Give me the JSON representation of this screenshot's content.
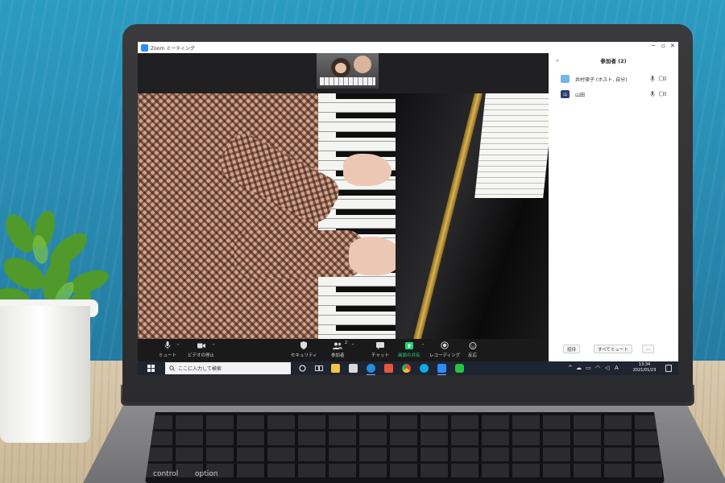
{
  "window": {
    "title": "Zoom ミーティング"
  },
  "toolbar": {
    "mute": "ミュート",
    "stop_video": "ビデオの停止",
    "security": "セキュリティ",
    "participants": "参加者",
    "participants_count": "2",
    "chat": "チャット",
    "share_screen": "画面の共有",
    "record": "レコーディング",
    "reactions": "反応"
  },
  "participants_panel": {
    "title": "参加者 (2)",
    "participants": [
      {
        "name": "井村律子 (ホスト, 自分)",
        "avatar_text": "",
        "avatar_color": "#6fb8e8"
      },
      {
        "name": "山田",
        "avatar_text": "山",
        "avatar_color": "#2b3d6e"
      }
    ],
    "invite_label": "招待",
    "mute_all_label": "すべてミュート",
    "more_label": "..."
  },
  "taskbar": {
    "search_placeholder": "ここに入力して検索",
    "ime": "A",
    "time": "13:34",
    "date": "2021/01/23"
  },
  "keyboard": {
    "control": "control",
    "option": "option"
  },
  "colors": {
    "zoom_blue": "#2d8cff",
    "share_green": "#26d07c",
    "taskbar_bg": "#1f2530",
    "toolbar_bg": "#1a1a1a"
  }
}
